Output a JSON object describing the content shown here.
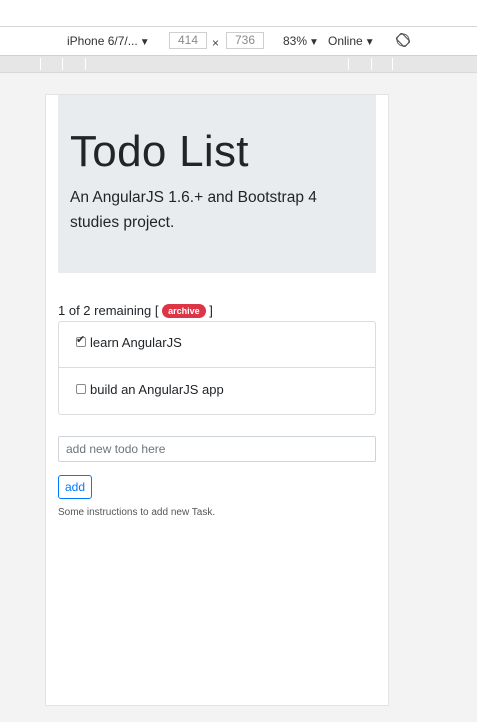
{
  "devtools": {
    "device_name": "iPhone 6/7/...",
    "width": "414",
    "height": "736",
    "times": "×",
    "zoom": "83%",
    "throttle": "Online",
    "dropdown_arrow": "▼"
  },
  "app": {
    "title": "Todo List",
    "subtitle": "An AngularJS 1.6.+ and Bootstrap 4 studies project.",
    "remaining_text": "1 of 2 remaining [",
    "archive_label": "archive",
    "remaining_close": "]",
    "todos": [
      {
        "text": "learn AngularJS",
        "done": true
      },
      {
        "text": "build an AngularJS app",
        "done": false
      }
    ],
    "input_placeholder": "add new todo here",
    "add_label": "add",
    "help_text": "Some instructions to add new Task."
  },
  "colors": {
    "badge": "#dc3545",
    "primary": "#007bff",
    "jumbotron": "#e9ecef"
  }
}
